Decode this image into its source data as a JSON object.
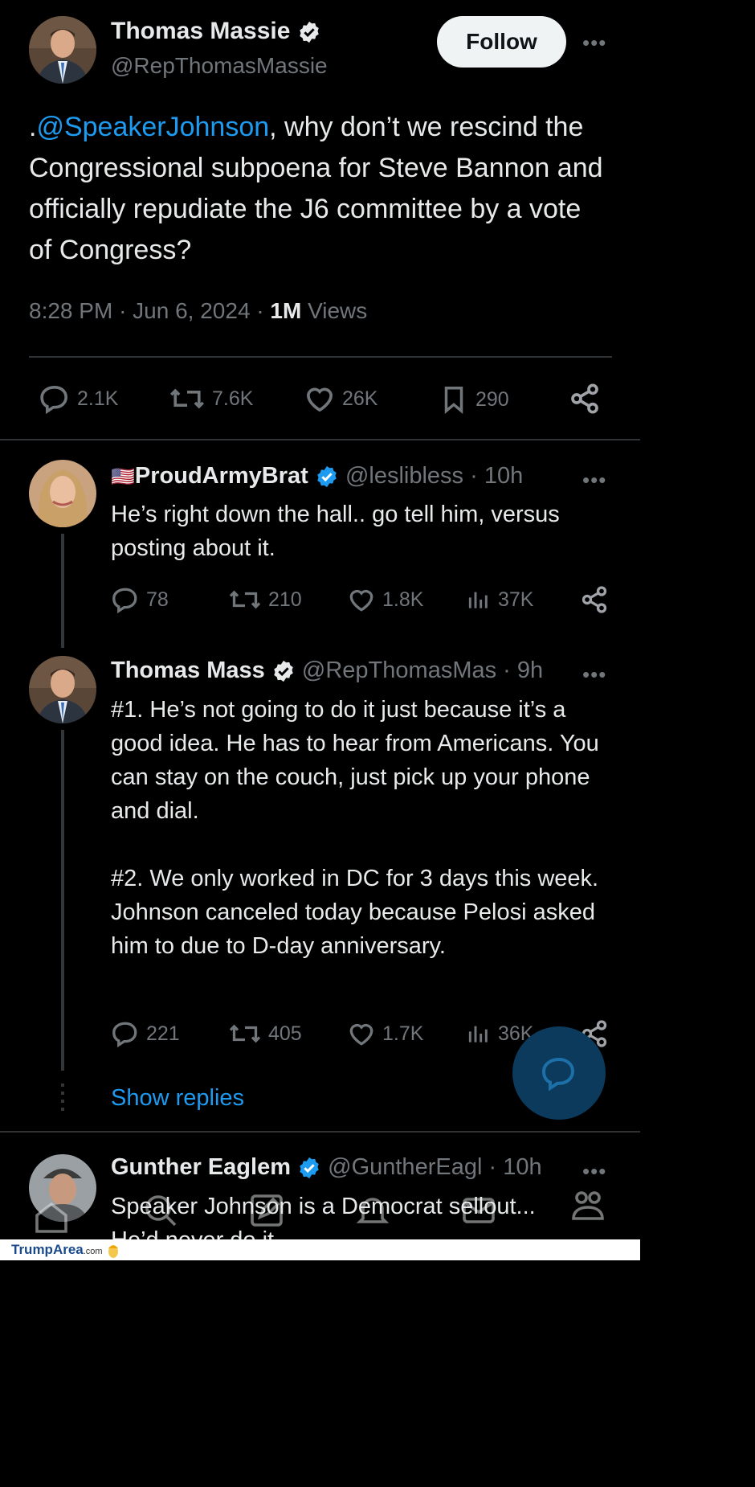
{
  "main_tweet": {
    "author_name": "Thomas Massie",
    "author_handle": "@RepThomasMassie",
    "follow_label": "Follow",
    "text_prefix": ".",
    "mention": "@SpeakerJohnson",
    "text_body": ", why don’t we rescind the Congressional subpoena for Steve Bannon and officially repudiate the J6 committee by a vote of Congress?",
    "time": "8:28 PM",
    "date": "Jun 6, 2024",
    "views_count": "1M",
    "views_label": "Views",
    "stats": {
      "replies": "2.1K",
      "reposts": "7.6K",
      "likes": "26K",
      "bookmarks": "290"
    }
  },
  "replies": [
    {
      "flag": "🇺🇸",
      "author_name": "ProudArmyBrat",
      "author_handle": "@leslibless",
      "time": "10h",
      "text": "He’s right down the hall.. go tell him, versus posting about it.",
      "stats": {
        "replies": "78",
        "reposts": "210",
        "likes": "1.8K",
        "views": "37K"
      }
    },
    {
      "author_name": "Thomas Mass",
      "author_handle": "@RepThomasMas",
      "time": "9h",
      "text": "#1. He’s not going to do it just because it’s a good idea. He has to hear from Americans. You can stay on the couch, just pick up your phone and dial.\n\n#2. We only worked in DC for 3 days this week. Johnson canceled today because Pelosi asked him to due to D-day anniversary.",
      "stats": {
        "replies": "221",
        "reposts": "405",
        "likes": "1.7K",
        "views": "36K"
      }
    },
    {
      "author_name": "Gunther Eaglem",
      "author_handle": "@GuntherEagl",
      "time": "10h",
      "text": "Speaker Johnson is a Democrat sellout...\nHe’d never do it"
    }
  ],
  "show_replies_label": "Show replies",
  "separator": "·",
  "more_glyph": "•••",
  "watermark": {
    "brand": "TrumpArea",
    "suffix": ".com"
  },
  "colors": {
    "accent": "#1d9bf0",
    "background": "#000000",
    "text": "#e7e9ea",
    "muted": "#71767b"
  }
}
